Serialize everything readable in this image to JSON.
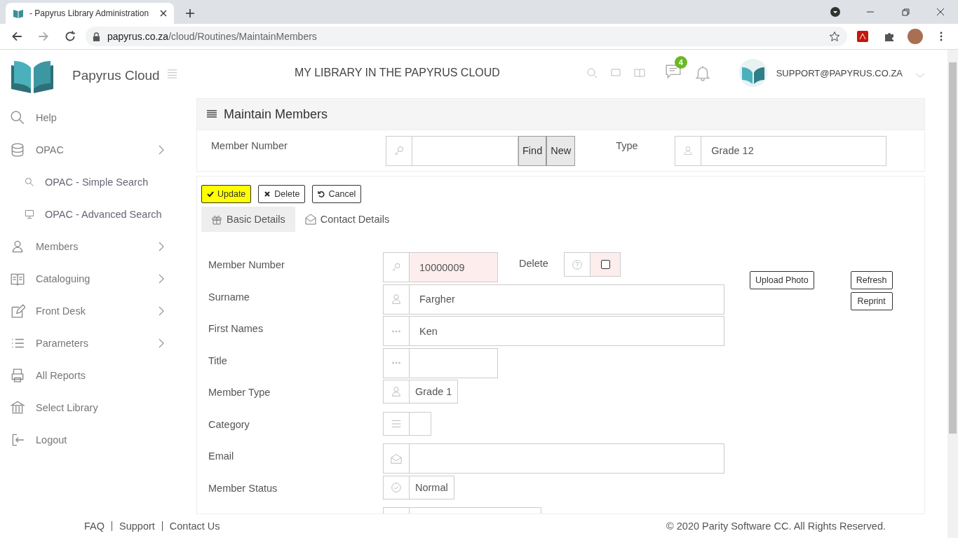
{
  "browser": {
    "tab_title": "- Papyrus Library Administration",
    "url_host": "papyrus.co.za",
    "url_path": "/cloud/Routines/MaintainMembers"
  },
  "sidebar": {
    "brand": "Papyrus Cloud",
    "items": [
      {
        "label": "Help",
        "kind": "link"
      },
      {
        "label": "OPAC",
        "kind": "group",
        "children": [
          {
            "label": "OPAC - Simple Search"
          },
          {
            "label": "OPAC - Advanced Search"
          }
        ]
      },
      {
        "label": "Members",
        "kind": "group"
      },
      {
        "label": "Cataloguing",
        "kind": "group"
      },
      {
        "label": "Front Desk",
        "kind": "group"
      },
      {
        "label": "Parameters",
        "kind": "group"
      },
      {
        "label": "All Reports",
        "kind": "link"
      },
      {
        "label": "Select Library",
        "kind": "link"
      },
      {
        "label": "Logout",
        "kind": "link"
      }
    ]
  },
  "header": {
    "title": "MY LIBRARY IN THE PAPYRUS CLOUD",
    "message_count": "4",
    "user": "SUPPORT@PAPYRUS.CO.ZA"
  },
  "panel": {
    "title": "Maintain Members",
    "lookup": {
      "label": "Member Number",
      "buttons": [
        "Find",
        "New"
      ],
      "type_label": "Type",
      "type_value": "Grade 12"
    },
    "actions": [
      {
        "label": "Update",
        "highlighted": true
      },
      {
        "label": "Delete",
        "highlighted": false
      },
      {
        "label": "Cancel",
        "highlighted": false
      }
    ],
    "tabs": [
      {
        "label": "Basic Details",
        "selected": true
      },
      {
        "label": "Contact Details",
        "selected": false
      }
    ],
    "fields": [
      {
        "label": "Member Number",
        "value": "10000009",
        "kind": "short",
        "invalid": true,
        "delete": {
          "label": "Delete",
          "checked": false
        }
      },
      {
        "label": "Surname",
        "value": "Fargher",
        "kind": "long",
        "invalid": false
      },
      {
        "label": "First Names",
        "value": "Ken",
        "kind": "long",
        "invalid": false
      },
      {
        "label": "Title",
        "kind": "short",
        "invalid": false
      },
      {
        "label": "Member Type",
        "value": "Grade 1",
        "kind": "fit",
        "invalid": false
      },
      {
        "label": "Category",
        "kind": "tiny",
        "invalid": false
      },
      {
        "label": "Email",
        "kind": "long",
        "invalid": false
      },
      {
        "label": "Member Status",
        "value": "Normal",
        "kind": "fit",
        "invalid": false
      },
      {
        "kind": "medium",
        "invalid": false
      }
    ],
    "photo_button": "Upload Photo",
    "side_buttons": [
      "Refresh",
      "Reprint"
    ]
  },
  "footer": {
    "links": [
      "FAQ",
      "Support",
      "Contact Us"
    ],
    "copyright": "© 2020 Parity Software CC. All Rights Reserved."
  }
}
